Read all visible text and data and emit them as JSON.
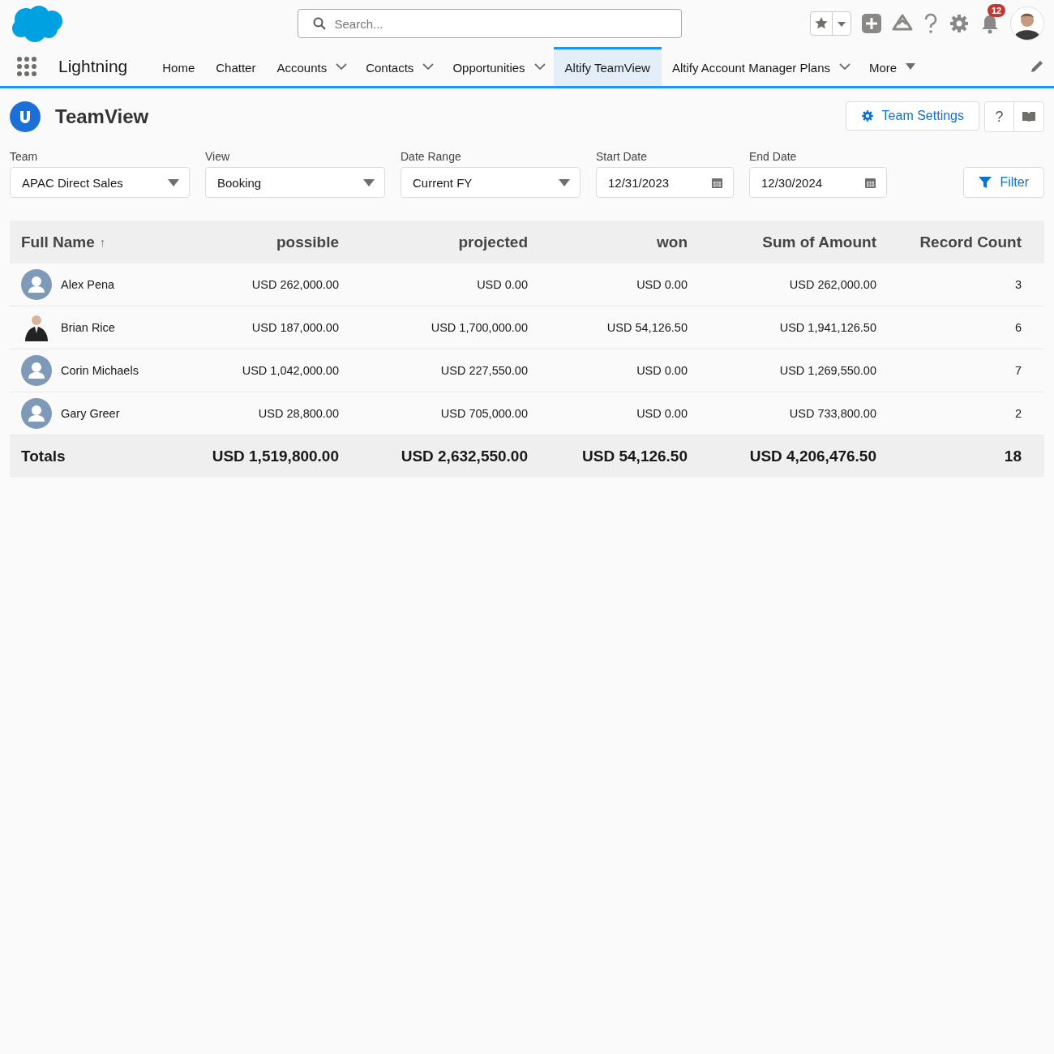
{
  "header": {
    "search": {
      "placeholder": "Search..."
    },
    "notifications": {
      "count": "12"
    }
  },
  "nav": {
    "app_name": "Lightning",
    "tabs": [
      {
        "label": "Home",
        "selected": false,
        "kind": "plain"
      },
      {
        "label": "Chatter",
        "selected": false,
        "kind": "plain"
      },
      {
        "label": "Accounts",
        "selected": false,
        "kind": "chevron"
      },
      {
        "label": "Contacts",
        "selected": false,
        "kind": "chevron"
      },
      {
        "label": "Opportunities",
        "selected": false,
        "kind": "chevron"
      },
      {
        "label": "Altify TeamView",
        "selected": true,
        "kind": "plain"
      },
      {
        "label": "Altify Account Manager Plans",
        "selected": false,
        "kind": "chevron"
      },
      {
        "label": "More",
        "selected": false,
        "kind": "caret"
      }
    ]
  },
  "page": {
    "title": "TeamView",
    "team_settings_button": "Team Settings",
    "help_button": "?"
  },
  "filters": [
    {
      "label": "Team",
      "value": "APAC Direct Sales",
      "kind": "select"
    },
    {
      "label": "View",
      "value": "Booking",
      "kind": "select"
    },
    {
      "label": "Date Range",
      "value": "Current FY",
      "kind": "select"
    },
    {
      "label": "Start Date",
      "value": "12/31/2023",
      "kind": "date"
    },
    {
      "label": "End Date",
      "value": "12/30/2024",
      "kind": "date"
    }
  ],
  "filter_button": "Filter",
  "table": {
    "columns": [
      "Full Name",
      "possible",
      "projected",
      "won",
      "Sum of Amount",
      "Record Count"
    ],
    "sort_mark": "↑",
    "rows": [
      {
        "kind": "placeholder",
        "cells": [
          "Alex Pena",
          "USD 262,000.00",
          "USD 0.00",
          "USD 0.00",
          "USD 262,000.00",
          "3"
        ]
      },
      {
        "kind": "photo",
        "cells": [
          "Brian Rice",
          "USD 187,000.00",
          "USD 1,700,000.00",
          "USD 54,126.50",
          "USD 1,941,126.50",
          "6"
        ]
      },
      {
        "kind": "placeholder",
        "cells": [
          "Corin Michaels",
          "USD 1,042,000.00",
          "USD 227,550.00",
          "USD 0.00",
          "USD 1,269,550.00",
          "7"
        ]
      },
      {
        "kind": "placeholder",
        "cells": [
          "Gary Greer",
          "USD 28,800.00",
          "USD 705,000.00",
          "USD 0.00",
          "USD 733,800.00",
          "2"
        ]
      }
    ],
    "totals": [
      "Totals",
      "USD 1,519,800.00",
      "USD 2,632,550.00",
      "USD 54,126.50",
      "USD 4,206,476.50",
      "18"
    ]
  }
}
